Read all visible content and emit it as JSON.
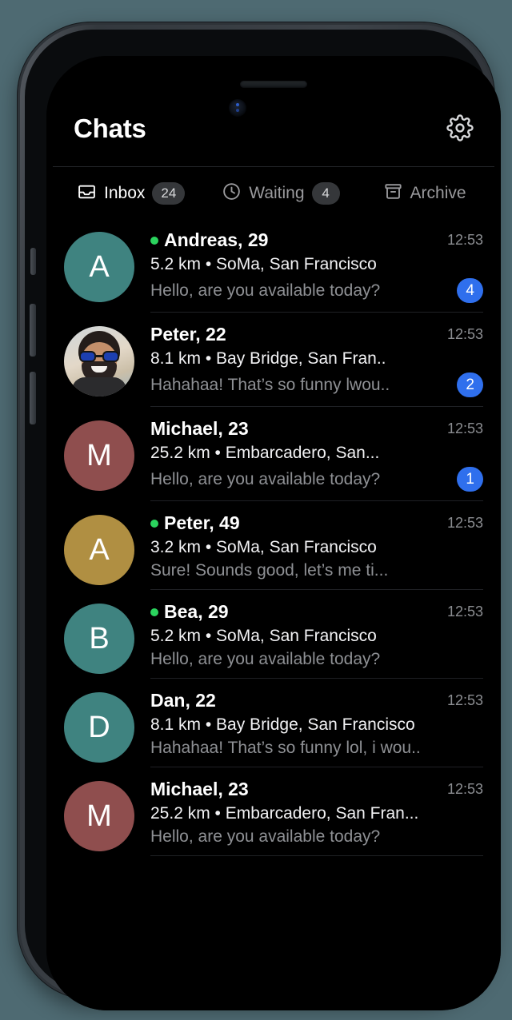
{
  "header": {
    "title": "Chats",
    "settings_icon": "gear-icon"
  },
  "tabs": [
    {
      "label": "Inbox",
      "count": "24",
      "icon": "inbox-tray-icon",
      "active": true
    },
    {
      "label": "Waiting",
      "count": "4",
      "icon": "clock-icon",
      "active": false
    },
    {
      "label": "Archive",
      "count": "",
      "icon": "archive-box-icon",
      "active": false
    }
  ],
  "chats": [
    {
      "avatar_type": "initial",
      "initial": "A",
      "avatar_color": "#3f8380",
      "online": true,
      "name": "Andreas, 29",
      "location": "5.2 km • SoMa, San Francisco",
      "preview": "Hello, are you available today?",
      "time": "12:53",
      "unread": "4"
    },
    {
      "avatar_type": "photo",
      "initial": "",
      "avatar_color": "#cbbfa8",
      "online": false,
      "name": "Peter, 22",
      "location": "8.1 km • Bay Bridge, San Fran..",
      "preview": "Hahahaa! That’s so funny lwou..",
      "time": "12:53",
      "unread": "2"
    },
    {
      "avatar_type": "initial",
      "initial": "M",
      "avatar_color": "#8f4e4e",
      "online": false,
      "name": "Michael, 23",
      "location": "25.2 km • Embarcadero, San...",
      "preview": "Hello, are you available today?",
      "time": "12:53",
      "unread": "1"
    },
    {
      "avatar_type": "initial",
      "initial": "A",
      "avatar_color": "#b08f42",
      "online": true,
      "name": "Peter, 49",
      "location": "3.2 km • SoMa, San Francisco",
      "preview": "Sure! Sounds good, let’s me ti...",
      "time": "12:53",
      "unread": ""
    },
    {
      "avatar_type": "initial",
      "initial": "B",
      "avatar_color": "#3f8380",
      "online": true,
      "name": "Bea, 29",
      "location": "5.2 km • SoMa, San Francisco",
      "preview": "Hello, are you available today?",
      "time": "12:53",
      "unread": ""
    },
    {
      "avatar_type": "initial",
      "initial": "D",
      "avatar_color": "#3f8380",
      "online": false,
      "name": "Dan, 22",
      "location": "8.1 km • Bay Bridge, San Francisco",
      "preview": "Hahahaa! That’s so funny lol, i wou..",
      "time": "12:53",
      "unread": ""
    },
    {
      "avatar_type": "initial",
      "initial": "M",
      "avatar_color": "#8f4e4e",
      "online": false,
      "name": "Michael, 23",
      "location": "25.2 km • Embarcadero, San Fran...",
      "preview": "Hello, are you available today?",
      "time": "12:53",
      "unread": ""
    }
  ],
  "colors": {
    "background": "#000000",
    "badge_blue": "#2f6fed",
    "online_green": "#2bd45e",
    "pill_gray": "#35373a",
    "muted_text": "#8e9094"
  }
}
